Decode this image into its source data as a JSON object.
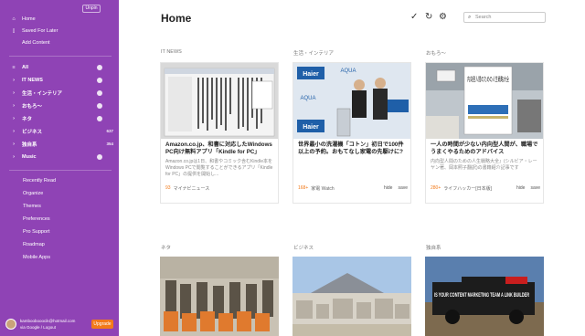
{
  "sidebar": {
    "unpin_label": "Unpin",
    "top_items": [
      {
        "label": "Home",
        "icon": "home-icon"
      },
      {
        "label": "Saved For Later",
        "icon": "bookmark-icon"
      },
      {
        "label": "Add Content",
        "icon": ""
      }
    ],
    "categories": [
      {
        "label": "All",
        "count": ""
      },
      {
        "label": "IT NEWS",
        "count": ""
      },
      {
        "label": "生活・インテリア",
        "count": ""
      },
      {
        "label": "おもろ～",
        "count": ""
      },
      {
        "label": "ネタ",
        "count": ""
      },
      {
        "label": "ビジネス",
        "count": "637"
      },
      {
        "label": "独自系",
        "count": "354"
      },
      {
        "label": "Music",
        "count": ""
      }
    ],
    "links": [
      "Recently Read",
      "Organize",
      "Themes",
      "Preferences",
      "Pro Support",
      "Roadmap",
      "Mobile Apps"
    ],
    "footer": {
      "email": "kamboobooocik@hotmail.com",
      "via": "via Google / Logout",
      "upgrade_label": "Upgrade"
    },
    "accent_color": "#8f43b5"
  },
  "main": {
    "title": "Home",
    "toolbar": {
      "check_icon": "check-icon",
      "refresh_icon": "refresh-icon",
      "settings_icon": "gear-icon"
    },
    "search": {
      "placeholder": "Search"
    },
    "columns_top": [
      "IT NEWS",
      "生活・インテリア",
      "おもろ～"
    ],
    "columns_bottom": [
      "ネタ",
      "ビジネス",
      "独自系"
    ],
    "cards": [
      {
        "title": "Amazon.co.jp、和書に対応したWindows PC向け無料アプリ「Kindle for PC」",
        "desc": "Amazon.co.jpは1日、和書やコミック含むKindle本をWindows PCで閲覧することができるアプリ「Kindle for PC」の提供を開始し...",
        "count": "93",
        "source": "マイナビニュース",
        "hide": "",
        "save": ""
      },
      {
        "title": "世界最小の洗濯機「コトン」初日で100件以上の予約。おもてなし家電の先駆けに?",
        "desc": "",
        "count": "168+",
        "source": "家電 Watch",
        "hide": "hide",
        "save": "save"
      },
      {
        "title": "一人の時間が少ない内向型人間が、職場でうまくやるためのアドバイス",
        "desc": "内向型人間のための人生戦略大全』(シルビア・レーヤン著、岡本照子翻訳)の書籍紹介記事です",
        "count": "280+",
        "source": "ライフハッカー[日本版]",
        "hide": "hide",
        "save": "save"
      }
    ],
    "overlay_texts": {
      "haier": "Haier",
      "aqua": "AQUA",
      "book": "内向型人間のための人生戦略大全",
      "banner": "IS YOUR CONTENT MARKETING TEAM A LINK BUILDER"
    }
  }
}
